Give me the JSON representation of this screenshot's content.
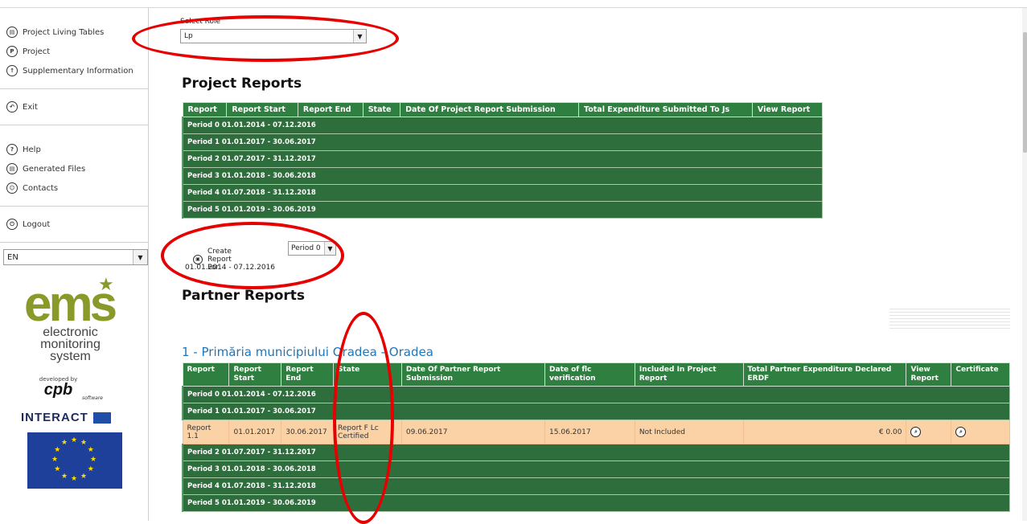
{
  "sidebar": {
    "groups": [
      [
        {
          "label": "Project Living Tables",
          "icon": "table-icon",
          "glyph": "▤"
        },
        {
          "label": "Project",
          "icon": "project-icon",
          "glyph": "P"
        },
        {
          "label": "Supplementary Information",
          "icon": "info-icon",
          "glyph": "↑"
        }
      ],
      [
        {
          "label": "Exit",
          "icon": "exit-icon",
          "glyph": "↶"
        }
      ],
      [
        {
          "label": "Help",
          "icon": "help-icon",
          "glyph": "?"
        },
        {
          "label": "Generated Files",
          "icon": "files-icon",
          "glyph": "▤"
        },
        {
          "label": "Contacts",
          "icon": "contacts-icon",
          "glyph": "☺"
        }
      ],
      [
        {
          "label": "Logout",
          "icon": "power-icon",
          "glyph": "⏻"
        }
      ]
    ],
    "language": "EN",
    "logo": {
      "mark": "ems",
      "lines": [
        "electronic",
        "monitoring",
        "system"
      ],
      "developed_by": "developed by",
      "cpb": "cpb",
      "cpb_sub": "software",
      "interact": "INTERACT"
    }
  },
  "role": {
    "label": "Select Role",
    "value": "Lp"
  },
  "project_reports": {
    "title": "Project Reports",
    "columns": [
      "Report",
      "Report Start",
      "Report End",
      "State",
      "Date Of Project Report Submission",
      "Total Expenditure Submitted To Js",
      "View Report"
    ],
    "periods": [
      "Period 0 01.01.2014 - 07.12.2016",
      "Period 1 01.01.2017 - 30.06.2017",
      "Period 2 01.07.2017 - 31.12.2017",
      "Period 3 01.01.2018 - 30.06.2018",
      "Period 4 01.07.2018 - 31.12.2018",
      "Period 5 01.01.2019 - 30.06.2019"
    ]
  },
  "create_report": {
    "button_label": "Create Report For",
    "period_value": "Period 0",
    "dates": "01.01.2014 - 07.12.2016"
  },
  "partner_reports": {
    "title": "Partner Reports",
    "partner_name": "1 - Primăria municipiului Oradea - Oradea",
    "columns": [
      "Report",
      "Report Start",
      "Report End",
      "State",
      "Date Of Partner Report Submission",
      "Date of flc verification",
      "Included In Project Report",
      "Total Partner Expenditure Declared ERDF",
      "View Report",
      "Certificate"
    ],
    "periods_before": [
      "Period 0 01.01.2014 - 07.12.2016",
      "Period 1 01.01.2017 - 30.06.2017"
    ],
    "row": {
      "report": "Report 1.1",
      "start": "01.01.2017",
      "end": "30.06.2017",
      "state": "Report F Lc Certified",
      "submission": "09.06.2017",
      "flc": "15.06.2017",
      "included": "Not Included",
      "total": "€ 0.00"
    },
    "periods_after": [
      "Period 2 01.07.2017 - 31.12.2017",
      "Period 3 01.01.2018 - 30.06.2018",
      "Period 4 01.07.2018 - 31.12.2018",
      "Period 5 01.01.2019 - 30.06.2019"
    ]
  },
  "colors": {
    "header_green": "#2f8040",
    "period_green": "#2e6d3c",
    "highlight_row": "#fbd2a6",
    "link_blue": "#2176b8",
    "annotation_red": "#e60000"
  }
}
